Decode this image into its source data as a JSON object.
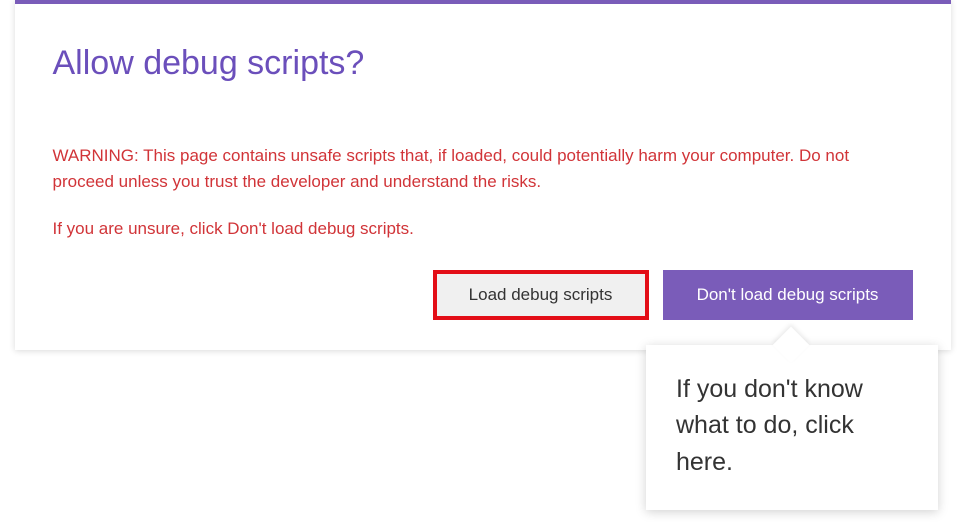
{
  "dialog": {
    "title": "Allow debug scripts?",
    "warning_line1": "WARNING: This page contains unsafe scripts that, if loaded, could potentially harm your computer. Do not proceed unless you trust the developer and understand the risks.",
    "warning_line2": "If you are unsure, click Don't load debug scripts.",
    "buttons": {
      "load": "Load debug scripts",
      "dont_load": "Don't load debug scripts"
    }
  },
  "tooltip": {
    "text": "If you don't know what to do, click here."
  },
  "colors": {
    "accent": "#7a5cb9",
    "danger": "#d13438",
    "highlight_border": "#e30e17"
  }
}
